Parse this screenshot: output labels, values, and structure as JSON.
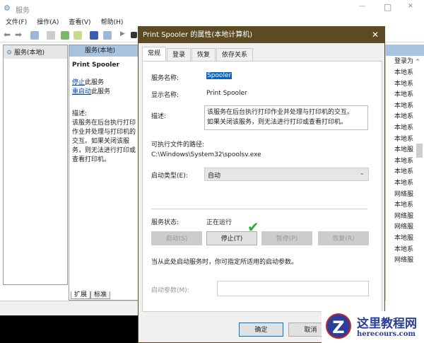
{
  "window": {
    "title": "服务",
    "controls": {
      "minimize": "—",
      "maximize": "□",
      "close": "✕"
    }
  },
  "menu": [
    "文件(F)",
    "操作(A)",
    "查看(V)",
    "帮助(H)"
  ],
  "tree": {
    "root": "服务(本地)"
  },
  "middle": {
    "header": "服务(本地)",
    "service_name": "Print Spooler",
    "stop_link": "停止",
    "stop_suffix": "此服务",
    "restart_link": "重启动",
    "restart_suffix": "此服务",
    "desc_label": "描述:",
    "desc_text": "该服务在后台执行打印作业并处理与打印机的交互。如果关闭该服务，则无法进行打印或查看打印机。",
    "tabs": [
      "扩展",
      "标准"
    ]
  },
  "list": {
    "header": "登录为",
    "rows": [
      "本地系",
      "本地系",
      "本地系",
      "本地系",
      "本地系",
      "本地系",
      "本地系",
      "本地服",
      "本地系",
      "本地系",
      "本地系",
      "网络服",
      "本地系",
      "网络服",
      "网络服",
      "本地服",
      "本地系",
      "网络服"
    ]
  },
  "dialog": {
    "title": "Print Spooler 的属性(本地计算机)",
    "close": "✕",
    "tabs": [
      "常规",
      "登录",
      "恢复",
      "依存关系"
    ],
    "service_name_label": "服务名称:",
    "service_name": "Spooler",
    "display_name_label": "显示名称:",
    "display_name": "Print Spooler",
    "desc_label": "描述:",
    "desc": "该服务在后台执行打印作业并处理与打印机的交互。如果关闭该服务，则无法进行打印或查看打印机。",
    "path_label": "可执行文件的路径:",
    "path": "C:\\Windows\\System32\\spoolsv.exe",
    "startup_type_label": "启动类型(E):",
    "startup_type": "自动",
    "status_label": "服务状态:",
    "status": "正在运行",
    "buttons": {
      "start": "启动(S)",
      "stop": "停止(T)",
      "pause": "暂停(P)",
      "resume": "恢复(R)"
    },
    "hint": "当从此处启动服务时，你可指定所适用的启动参数。",
    "params_label": "启动参数(M):",
    "params_value": "",
    "ok": "确定",
    "cancel": "取消"
  },
  "watermark": {
    "title": "这里教程网",
    "url": "herecours.com"
  }
}
